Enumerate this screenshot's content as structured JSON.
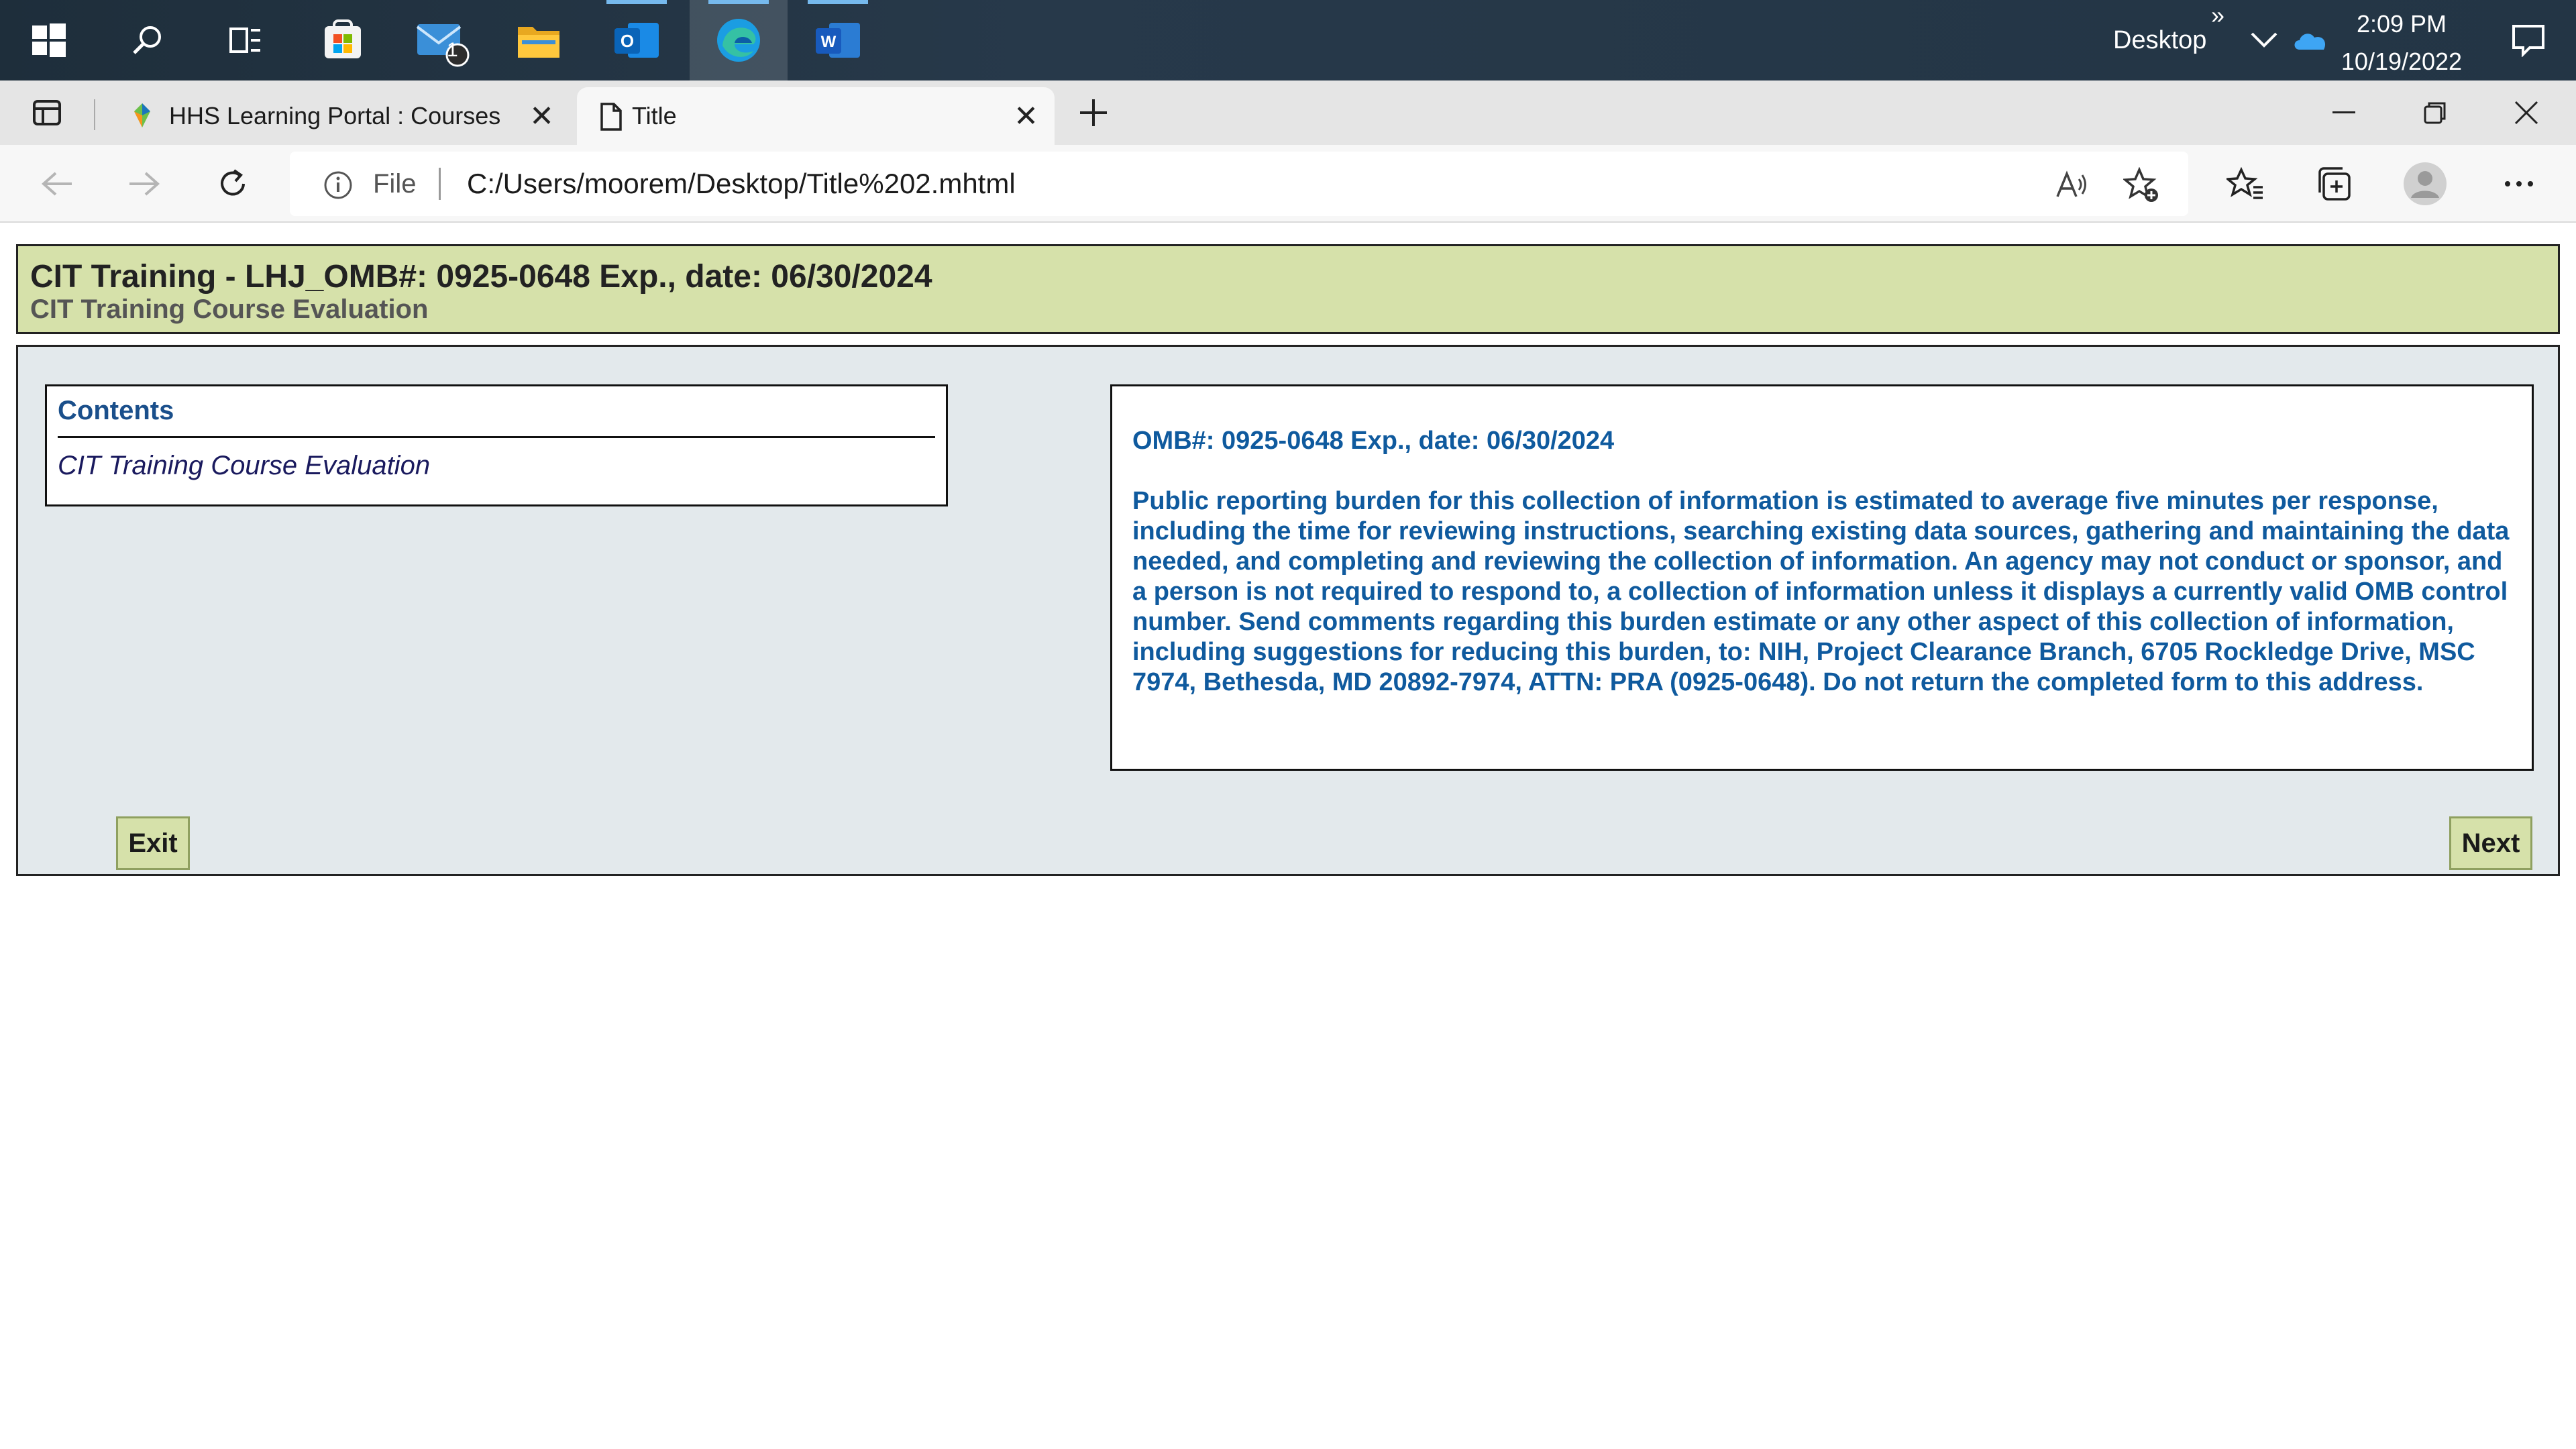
{
  "taskbar": {
    "mail_badge": "1",
    "desktop_label": "Desktop",
    "overflow_glyph": "»",
    "time": "2:09 PM",
    "date": "10/19/2022",
    "icons": [
      "windows-start-icon",
      "search-icon",
      "task-view-icon",
      "store-icon",
      "mail-icon",
      "file-explorer-icon",
      "outlook-icon",
      "edge-icon",
      "word-icon"
    ]
  },
  "browser": {
    "tabs": [
      {
        "title": "HHS Learning Portal : Courses",
        "active": false
      },
      {
        "title": "Title",
        "active": true
      }
    ],
    "file_label": "File",
    "url": "C:/Users/moorem/Desktop/Title%202.mhtml"
  },
  "page": {
    "header_title": "CIT Training - LHJ_OMB#: 0925-0648 Exp., date: 06/30/2024",
    "header_subtitle": "CIT Training Course Evaluation",
    "contents_heading": "Contents",
    "contents_item": "CIT Training Course Evaluation",
    "omb_heading": "OMB#: 0925-0648 Exp., date: 06/30/2024",
    "omb_text": "Public reporting burden for this collection of information is estimated to average five minutes per response, including the time for reviewing instructions, searching existing data sources, gathering and maintaining the data needed, and completing and reviewing the collection of information. An agency may not conduct or sponsor, and a person is not required to respond to, a collection of information unless it displays a currently valid OMB control number. Send comments regarding this burden estimate or any other aspect of this collection of information, including suggestions for reducing this burden, to: NIH, Project Clearance Branch, 6705 Rockledge Drive, MSC 7974, Bethesda, MD 20892-7974, ATTN: PRA (0925-0648). Do not return the completed form to this address.",
    "exit_label": "Exit",
    "next_label": "Next"
  },
  "colors": {
    "header_bg": "#d6e1aa",
    "panel_bg": "#e3e9ec",
    "text_blue": "#0f5a9e"
  }
}
